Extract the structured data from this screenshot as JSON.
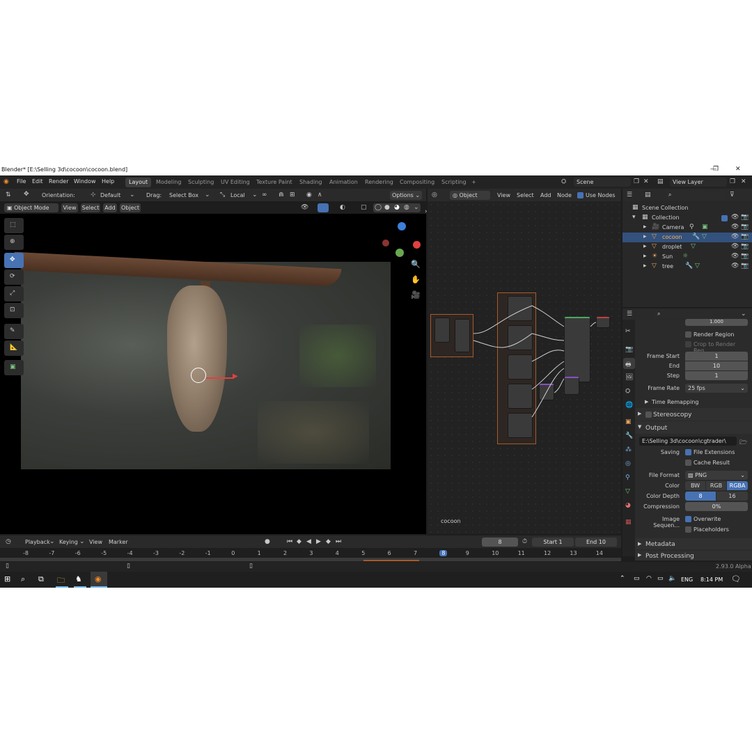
{
  "window": {
    "title": "Blender* [E:\\Selling 3d\\cocoon\\cocoon.blend]",
    "controls": [
      "—",
      "❐",
      "✕"
    ]
  },
  "menu": [
    "File",
    "Edit",
    "Render",
    "Window",
    "Help"
  ],
  "workspaces": [
    "Layout",
    "Modeling",
    "Sculpting",
    "UV Editing",
    "Texture Paint",
    "Shading",
    "Animation",
    "Rendering",
    "Compositing",
    "Scripting"
  ],
  "workspace_add": "+",
  "scene": {
    "name": "Scene",
    "view_layer": "View Layer"
  },
  "tool_header": {
    "orientation_label": "Orientation:",
    "orientation_value": "Default",
    "drag_label": "Drag:",
    "drag_value": "Select Box",
    "pivot": "Local",
    "options": "Options"
  },
  "viewport_header": {
    "mode": "Object Mode",
    "items": [
      "View",
      "Select",
      "Add",
      "Object"
    ]
  },
  "node_editor": {
    "object_type": "Object",
    "items": [
      "View",
      "Select",
      "Add",
      "Node"
    ],
    "use_nodes": "Use Nodes",
    "object_name": "cocoon"
  },
  "outliner": {
    "root": "Scene Collection",
    "collection": "Collection",
    "items": [
      "Camera",
      "cocoon",
      "droplet",
      "Sun",
      "tree"
    ]
  },
  "properties": {
    "top_value": "1.000",
    "render_region": "Render Region",
    "crop": "Crop to Render Reg...",
    "frame_start_label": "Frame Start",
    "frame_start": "1",
    "end_label": "End",
    "end": "10",
    "step_label": "Step",
    "step": "1",
    "frame_rate_label": "Frame Rate",
    "frame_rate": "25 fps",
    "time_remapping": "Time Remapping",
    "stereoscopy": "Stereoscopy",
    "output": "Output",
    "path": "E:\\Selling 3d\\cocoon\\cgtrader\\",
    "saving_label": "Saving",
    "file_extensions": "File Extensions",
    "cache_result": "Cache Result",
    "file_format_label": "File Format",
    "file_format": "PNG",
    "color_label": "Color",
    "color_options": [
      "BW",
      "RGB",
      "RGBA"
    ],
    "color_depth_label": "Color Depth",
    "color_depth_options": [
      "8",
      "16"
    ],
    "compression_label": "Compression",
    "compression": "0%",
    "image_sequence_label": "Image Sequen...",
    "overwrite": "Overwrite",
    "placeholders": "Placeholders",
    "metadata": "Metadata",
    "post_processing": "Post Processing"
  },
  "timeline": {
    "items": [
      "Playback",
      "Keying",
      "View",
      "Marker"
    ],
    "current_frame": "8",
    "start_label": "Start",
    "start": "1",
    "end_label": "End",
    "end": "10",
    "ticks": [
      "-8",
      "-7",
      "-6",
      "-5",
      "-4",
      "-3",
      "-2",
      "-1",
      "0",
      "1",
      "2",
      "3",
      "4",
      "5",
      "6",
      "7",
      "8",
      "9",
      "10",
      "11",
      "12",
      "13",
      "14"
    ]
  },
  "status": {
    "version": "2.93.0 Alpha"
  },
  "taskbar": {
    "lang": "ENG",
    "time": "8:14 PM"
  },
  "colors": {
    "accent": "#4772b3",
    "frame": "#a85a2a",
    "axis_x": "#e04040",
    "axis_y": "#6aa84f",
    "axis_z": "#3d7fd9"
  }
}
